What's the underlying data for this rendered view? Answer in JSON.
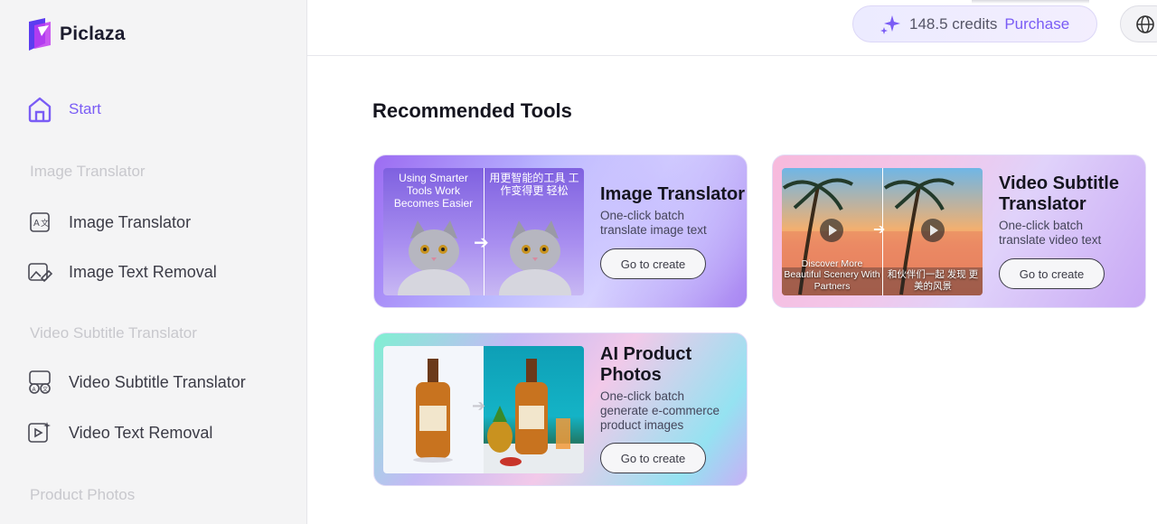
{
  "brand": {
    "name": "Piclaza"
  },
  "sidebar": {
    "start_label": "Start",
    "sections": [
      {
        "title": "Image Translator",
        "items": [
          {
            "label": "Image Translator",
            "icon": "translate-image-icon"
          },
          {
            "label": "Image Text Removal",
            "icon": "image-eraser-icon"
          }
        ]
      },
      {
        "title": "Video Subtitle Translator",
        "items": [
          {
            "label": "Video Subtitle Translator",
            "icon": "video-translate-icon"
          },
          {
            "label": "Video Text Removal",
            "icon": "video-eraser-icon"
          }
        ]
      },
      {
        "title": "Product Photos",
        "items": []
      }
    ]
  },
  "header": {
    "credits_amount": "148.5 credits",
    "purchase_label": "Purchase",
    "language_icon": "globe-icon"
  },
  "main": {
    "title": "Recommended Tools",
    "cards": [
      {
        "title": "Image Translator",
        "description": "One-click batch translate image text",
        "button": "Go to create",
        "thumb_text_left": "Using Smarter Tools Work Becomes Easier",
        "thumb_text_right": "用更智能的工具 工作变得更 轻松"
      },
      {
        "title": "Video Subtitle Translator",
        "description": "One-click batch translate video text",
        "button": "Go to create",
        "thumb_text_left": "Discover More Beautiful Scenery With Partners",
        "thumb_text_right": "和伙伴们一起 发现 更美的风景"
      },
      {
        "title": "AI Product Photos",
        "description": "One-click batch generate e-commerce product images",
        "button": "Go to create"
      }
    ]
  },
  "colors": {
    "accent": "#7a5cf5",
    "sidebar_bg": "#f4f4f5",
    "muted": "#c8c8cd"
  }
}
